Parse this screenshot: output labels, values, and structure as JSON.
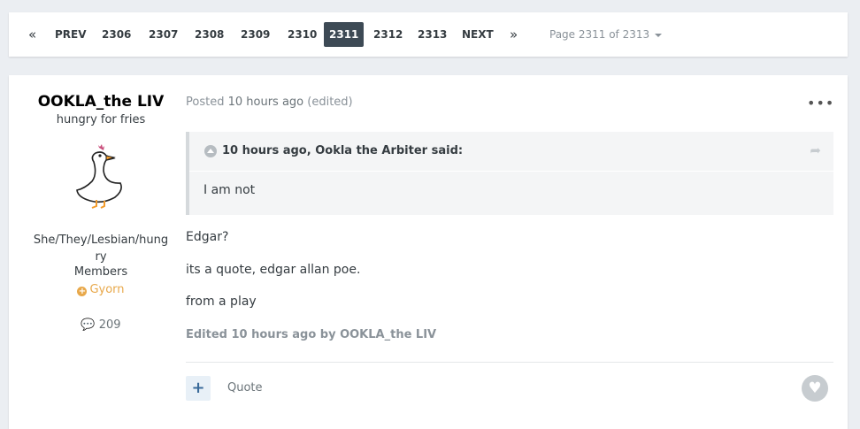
{
  "pagination": {
    "first_icon": "double-chevron-left-icon",
    "first_glyph": "«",
    "prev_label": "PREV",
    "pages": [
      "2306",
      "2307",
      "2308",
      "2309",
      "2310",
      "2311",
      "2312",
      "2313"
    ],
    "current_page": "2311",
    "next_label": "NEXT",
    "last_icon": "double-chevron-right-icon",
    "last_glyph": "»",
    "page_info": "Page 2311 of 2313"
  },
  "author": {
    "name": "OOKLA_the LIV",
    "tagline": "hungry for fries",
    "avatar_icon": "goose-avatar",
    "pronouns": "She/They/Lesbian/hungry",
    "group": "Members",
    "rank": "Gyorn",
    "post_count": "209",
    "post_count_icon": "comment-icon",
    "rank_color": "#e8a84a"
  },
  "post": {
    "posted_prefix": "Posted",
    "posted_time": "10 hours ago",
    "edited_tag": "(edited)",
    "menu_glyph": "•••",
    "quote": {
      "citation": "10 hours ago, Ookla the Arbiter said:",
      "text": "I am not",
      "share_icon": "share-icon"
    },
    "lines": [
      "Edgar?",
      "its a quote, edgar allan poe.",
      "from a play"
    ],
    "edited_note": "Edited 10 hours ago by OOKLA_the LIV",
    "multiquote_glyph": "+",
    "quote_label": "Quote",
    "reaction_icon": "heart-icon",
    "reaction_glyph": "♥"
  },
  "colors": {
    "background": "#ebeef2",
    "active_page": "#3d4a55",
    "link_muted": "#8a9299"
  }
}
